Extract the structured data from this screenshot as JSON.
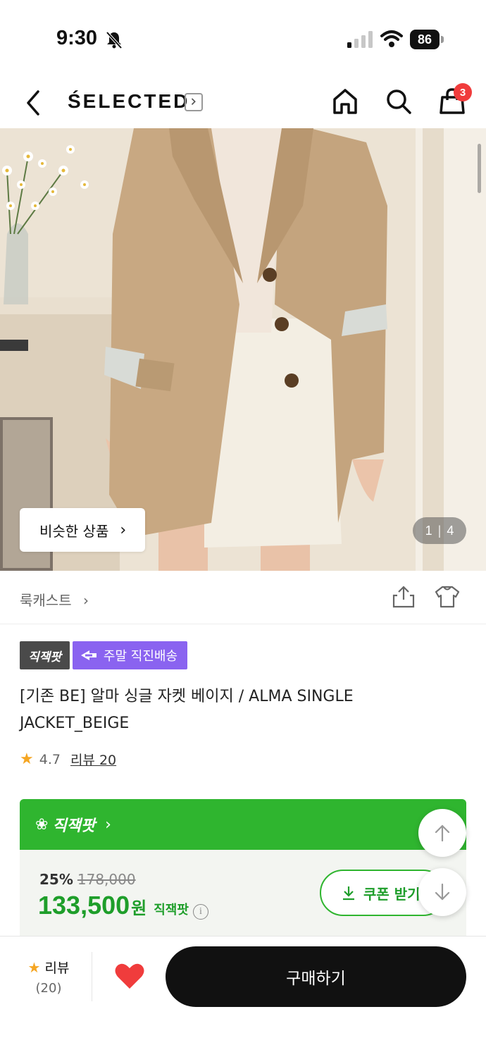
{
  "status_bar": {
    "time": "9:30",
    "battery": "86"
  },
  "header": {
    "brand": "ŚELECTED",
    "cart_count": "3"
  },
  "hero": {
    "similar_button": "비슷한 상품",
    "image_index": "1",
    "image_total": "4"
  },
  "lookcast": {
    "label": "룩캐스트"
  },
  "product": {
    "tag_main": "직잭팟",
    "tag_delivery": "주말 직진배송",
    "title": "[기존 BE] 알마 싱글 자켓 베이지 / ALMA SINGLE JACKET_BEIGE",
    "rating": "4.7",
    "review_link": "리뷰 20"
  },
  "deal": {
    "header_label": "직잭팟",
    "discount": "25%",
    "original_price": "178,000",
    "price": "133,500",
    "price_unit": "원",
    "price_tag": "직잭팟",
    "coupon_button": "쿠폰 받기"
  },
  "bottom_bar": {
    "review_label": "리뷰",
    "review_count": "(20)",
    "buy_button": "구매하기"
  },
  "colors": {
    "accent_green": "#2fb52f",
    "price_green": "#1e9e2a",
    "delivery_purple": "#8a63f0",
    "heart_red": "#f03c3c",
    "star": "#f5a623"
  },
  "icons": [
    "back-icon",
    "home-icon",
    "search-icon",
    "cart-icon",
    "share-icon",
    "fitting-icon",
    "info-icon",
    "download-icon",
    "arrow-up-icon",
    "arrow-down-icon",
    "heart-icon",
    "star-icon"
  ]
}
